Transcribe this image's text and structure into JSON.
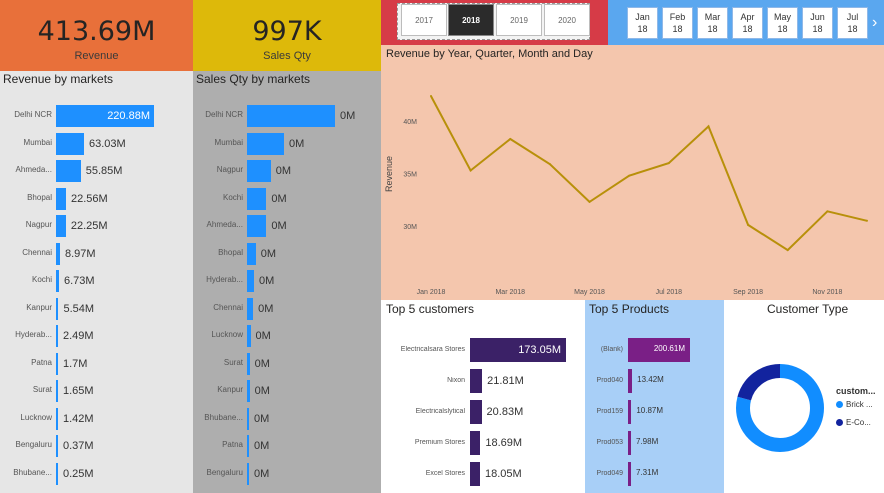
{
  "kpi_revenue": {
    "value": "413.69M",
    "label": "Revenue",
    "color": "#e8703a"
  },
  "kpi_qty": {
    "value": "997K",
    "label": "Sales Qty",
    "color": "#ddb90a"
  },
  "year_slicer": {
    "years": [
      "2017",
      "2018",
      "2019",
      "2020"
    ],
    "selected": "2018"
  },
  "month_slicer": {
    "months": [
      {
        "m": "Jan",
        "y": "18"
      },
      {
        "m": "Feb",
        "y": "18"
      },
      {
        "m": "Mar",
        "y": "18"
      },
      {
        "m": "Apr",
        "y": "18"
      },
      {
        "m": "May",
        "y": "18"
      },
      {
        "m": "Jun",
        "y": "18"
      },
      {
        "m": "Jul",
        "y": "18"
      }
    ],
    "next_icon": "chevron-right-icon"
  },
  "revenue_by_markets": {
    "title": "Revenue by markets",
    "rows": [
      {
        "name": "Delhi NCR",
        "value": 220.88,
        "label": "220.88M"
      },
      {
        "name": "Mumbai",
        "value": 63.03,
        "label": "63.03M"
      },
      {
        "name": "Ahmeda...",
        "value": 55.85,
        "label": "55.85M"
      },
      {
        "name": "Bhopal",
        "value": 22.56,
        "label": "22.56M"
      },
      {
        "name": "Nagpur",
        "value": 22.25,
        "label": "22.25M"
      },
      {
        "name": "Chennai",
        "value": 8.97,
        "label": "8.97M"
      },
      {
        "name": "Kochi",
        "value": 6.73,
        "label": "6.73M"
      },
      {
        "name": "Kanpur",
        "value": 5.54,
        "label": "5.54M"
      },
      {
        "name": "Hyderab...",
        "value": 2.49,
        "label": "2.49M"
      },
      {
        "name": "Patna",
        "value": 1.7,
        "label": "1.7M"
      },
      {
        "name": "Surat",
        "value": 1.65,
        "label": "1.65M"
      },
      {
        "name": "Lucknow",
        "value": 1.42,
        "label": "1.42M"
      },
      {
        "name": "Bengaluru",
        "value": 0.37,
        "label": "0.37M"
      },
      {
        "name": "Bhubane...",
        "value": 0.25,
        "label": "0.25M"
      }
    ]
  },
  "sales_qty_by_markets": {
    "title": "Sales Qty by markets",
    "rows": [
      {
        "name": "Delhi NCR",
        "value": 1.0,
        "label": "0M"
      },
      {
        "name": "Mumbai",
        "value": 0.42,
        "label": "0M"
      },
      {
        "name": "Nagpur",
        "value": 0.27,
        "label": "0M"
      },
      {
        "name": "Kochi",
        "value": 0.22,
        "label": "0M"
      },
      {
        "name": "Ahmeda...",
        "value": 0.22,
        "label": "0M"
      },
      {
        "name": "Bhopal",
        "value": 0.1,
        "label": "0M"
      },
      {
        "name": "Hyderab...",
        "value": 0.08,
        "label": "0M"
      },
      {
        "name": "Chennai",
        "value": 0.07,
        "label": "0M"
      },
      {
        "name": "Lucknow",
        "value": 0.04,
        "label": "0M"
      },
      {
        "name": "Surat",
        "value": 0.03,
        "label": "0M"
      },
      {
        "name": "Kanpur",
        "value": 0.03,
        "label": "0M"
      },
      {
        "name": "Bhubane...",
        "value": 0.02,
        "label": "0M"
      },
      {
        "name": "Patna",
        "value": 0.02,
        "label": "0M"
      },
      {
        "name": "Bengaluru",
        "value": 0.01,
        "label": "0M"
      }
    ]
  },
  "chart_data": {
    "type": "line",
    "title": "Revenue by Year, Quarter, Month and Day",
    "ylabel": "Revenue",
    "xlabel": "",
    "x": [
      "Jan 2018",
      "Feb 2018",
      "Mar 2018",
      "Apr 2018",
      "May 2018",
      "Jun 2018",
      "Jul 2018",
      "Aug 2018",
      "Sep 2018",
      "Oct 2018",
      "Nov 2018",
      "Dec 2018"
    ],
    "values": [
      42.4,
      35.3,
      38.3,
      35.9,
      32.3,
      34.8,
      36.0,
      39.5,
      30.1,
      27.7,
      31.4,
      30.5
    ],
    "yticks": [
      {
        "v": 40,
        "label": "40M"
      },
      {
        "v": 35,
        "label": "35M"
      },
      {
        "v": 30,
        "label": "30M"
      }
    ],
    "xticks": [
      "Jan 2018",
      "Mar 2018",
      "May 2018",
      "Jul 2018",
      "Sep 2018",
      "Nov 2018"
    ],
    "ylim": [
      25.8,
      44.6
    ],
    "line_color": "#b8900a",
    "background": "#f4c6ad"
  },
  "top_customers": {
    "title": "Top 5 customers",
    "rows": [
      {
        "name": "Electricalsara Stores",
        "value": 173.05,
        "label": "173.05M"
      },
      {
        "name": "Nixon",
        "value": 21.81,
        "label": "21.81M"
      },
      {
        "name": "Electricalslytical",
        "value": 20.83,
        "label": "20.83M"
      },
      {
        "name": "Premium Stores",
        "value": 18.69,
        "label": "18.69M"
      },
      {
        "name": "Excel Stores",
        "value": 18.05,
        "label": "18.05M"
      }
    ]
  },
  "top_products": {
    "title": "Top 5 Products",
    "rows": [
      {
        "name": "(Blank)",
        "value": 200.61,
        "label": "200.61M"
      },
      {
        "name": "Prod040",
        "value": 13.42,
        "label": "13.42M"
      },
      {
        "name": "Prod159",
        "value": 10.87,
        "label": "10.87M"
      },
      {
        "name": "Prod053",
        "value": 7.98,
        "label": "7.98M"
      },
      {
        "name": "Prod049",
        "value": 7.31,
        "label": "7.31M"
      }
    ]
  },
  "customer_type": {
    "title": "Customer Type",
    "legend_title": "custom...",
    "slices": [
      {
        "name": "Brick ...",
        "value": 0.79,
        "color": "#118dff"
      },
      {
        "name": "E-Co...",
        "value": 0.21,
        "color": "#12239e"
      }
    ]
  }
}
